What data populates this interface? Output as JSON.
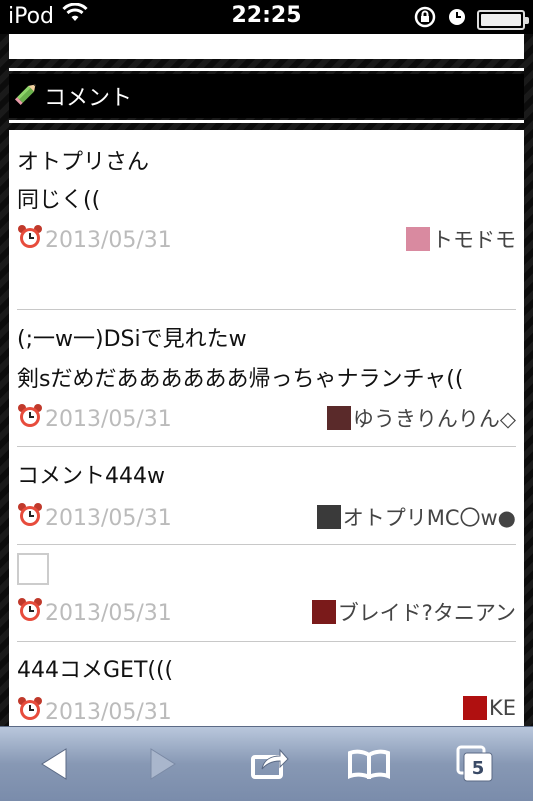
{
  "statusbar": {
    "carrier": "iPod",
    "time": "22:25"
  },
  "section": {
    "title": "コメント"
  },
  "comments": [
    {
      "lines": [
        "オトプリさん",
        "同じく(("
      ],
      "date": "2013/05/31",
      "author": "トモドモ",
      "avatar_color": "#d98aa0"
    },
    {
      "lines": [
        "(;一w一)DSiで見れたw",
        "剣sだめだああああああ帰っちゃナランチャ(("
      ],
      "date": "2013/05/31",
      "author": "ゆうきりんりん◇",
      "avatar_color": "#5a2a2a"
    },
    {
      "lines": [
        "コメント444w"
      ],
      "date": "2013/05/31",
      "author": "オトプリMC〇w●",
      "avatar_color": "#3a3a3a"
    },
    {
      "lines": [],
      "empty_box": true,
      "date": "2013/05/31",
      "author": "ブレイド?タニアン",
      "avatar_color": "#7a1a1a"
    },
    {
      "lines": [
        "444コメGET((("
      ],
      "date": "2013/05/31",
      "author": "KE",
      "avatar_color": "#b01010"
    }
  ],
  "toolbar": {
    "tabs_count": "5"
  },
  "colors": {
    "date": "#bbbbbb",
    "toolbar": "#8798b4"
  }
}
